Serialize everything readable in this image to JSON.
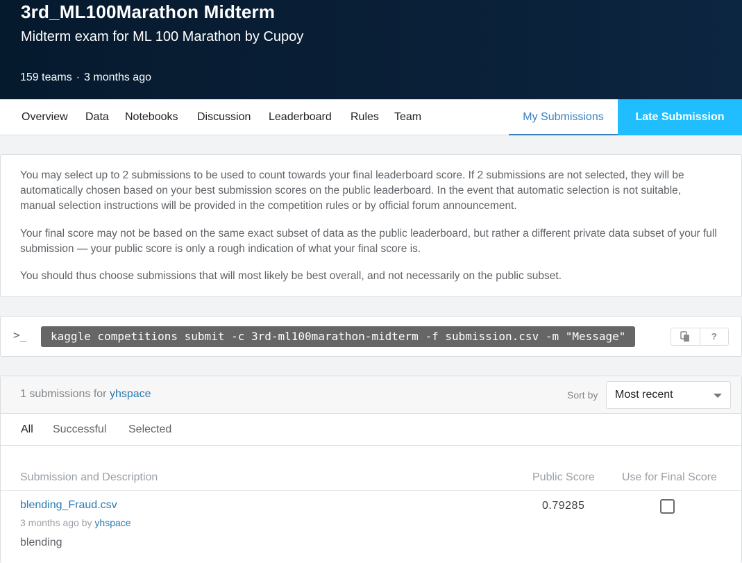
{
  "header": {
    "title": "3rd_ML100Marathon Midterm",
    "subtitle": "Midterm exam for ML 100 Marathon by Cupoy",
    "teams": "159 teams",
    "separator": "·",
    "age": "3 months ago"
  },
  "tabs": [
    "Overview",
    "Data",
    "Notebooks",
    "Discussion",
    "Leaderboard",
    "Rules",
    "Team"
  ],
  "my_submissions": "My Submissions",
  "late_submission": "Late Submission",
  "info": {
    "p1": "You may select up to 2 submissions to be used to count towards your final leaderboard score. If 2 submissions are not selected, they will be automatically chosen based on your best submission scores on the public leaderboard. In the event that automatic selection is not suitable, manual selection instructions will be provided in the competition rules or by official forum announcement.",
    "p2": "Your final score may not be based on the same exact subset of data as the public leaderboard, but rather a different private data subset of your full submission — your public score is only a rough indication of what your final score is.",
    "p3": "You should thus choose submissions that will most likely be best overall, and not necessarily on the public subset."
  },
  "cli": {
    "prompt": ">_",
    "command": "kaggle competitions submit -c 3rd-ml100marathon-midterm -f submission.csv -m \"Message\"",
    "help": "?"
  },
  "submissions": {
    "count_text": "1 submissions for",
    "user": "yhspace",
    "sort_label": "Sort by",
    "sort_value": "Most recent",
    "filters": [
      "All",
      "Successful",
      "Selected"
    ],
    "columns": {
      "description": "Submission and Description",
      "public_score": "Public Score",
      "use_final": "Use for Final Score"
    },
    "rows": [
      {
        "filename": "blending_Fraud.csv",
        "age": "3 months ago by",
        "user": "yhspace",
        "description": "blending",
        "score": "0.79285",
        "selected": false
      }
    ]
  }
}
